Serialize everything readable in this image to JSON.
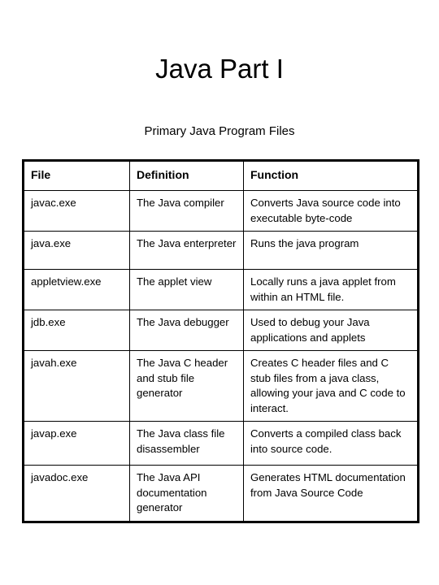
{
  "slide": {
    "title": "Java Part I",
    "subtitle": "Primary Java Program Files"
  },
  "table": {
    "headers": {
      "file": "File",
      "definition": "Definition",
      "function": "Function"
    },
    "rows": [
      {
        "file": "javac.exe",
        "definition": "The Java compiler",
        "function": "Converts Java source code into executable byte-code"
      },
      {
        "file": "java.exe",
        "definition": "The Java enterpreter",
        "function": "Runs the java program"
      },
      {
        "file": "appletview.exe",
        "definition": "The applet view",
        "function": "Locally runs a java applet from within an HTML file."
      },
      {
        "file": "jdb.exe",
        "definition": "The Java debugger",
        "function": "Used to debug your Java applications and applets"
      },
      {
        "file": "javah.exe",
        "definition": "The Java C header and stub file generator",
        "function": "Creates C header files and C stub files from a java class, allowing your java and C code to interact."
      },
      {
        "file": "javap.exe",
        "definition": "The Java class file disassembler",
        "function": "Converts a compiled class back into source code."
      },
      {
        "file": "javadoc.exe",
        "definition": "The Java API documentation generator",
        "function": "Generates HTML documentation from Java Source Code"
      }
    ]
  },
  "colors": {
    "background": "#ffffff",
    "text": "#000000",
    "border": "#000000"
  }
}
